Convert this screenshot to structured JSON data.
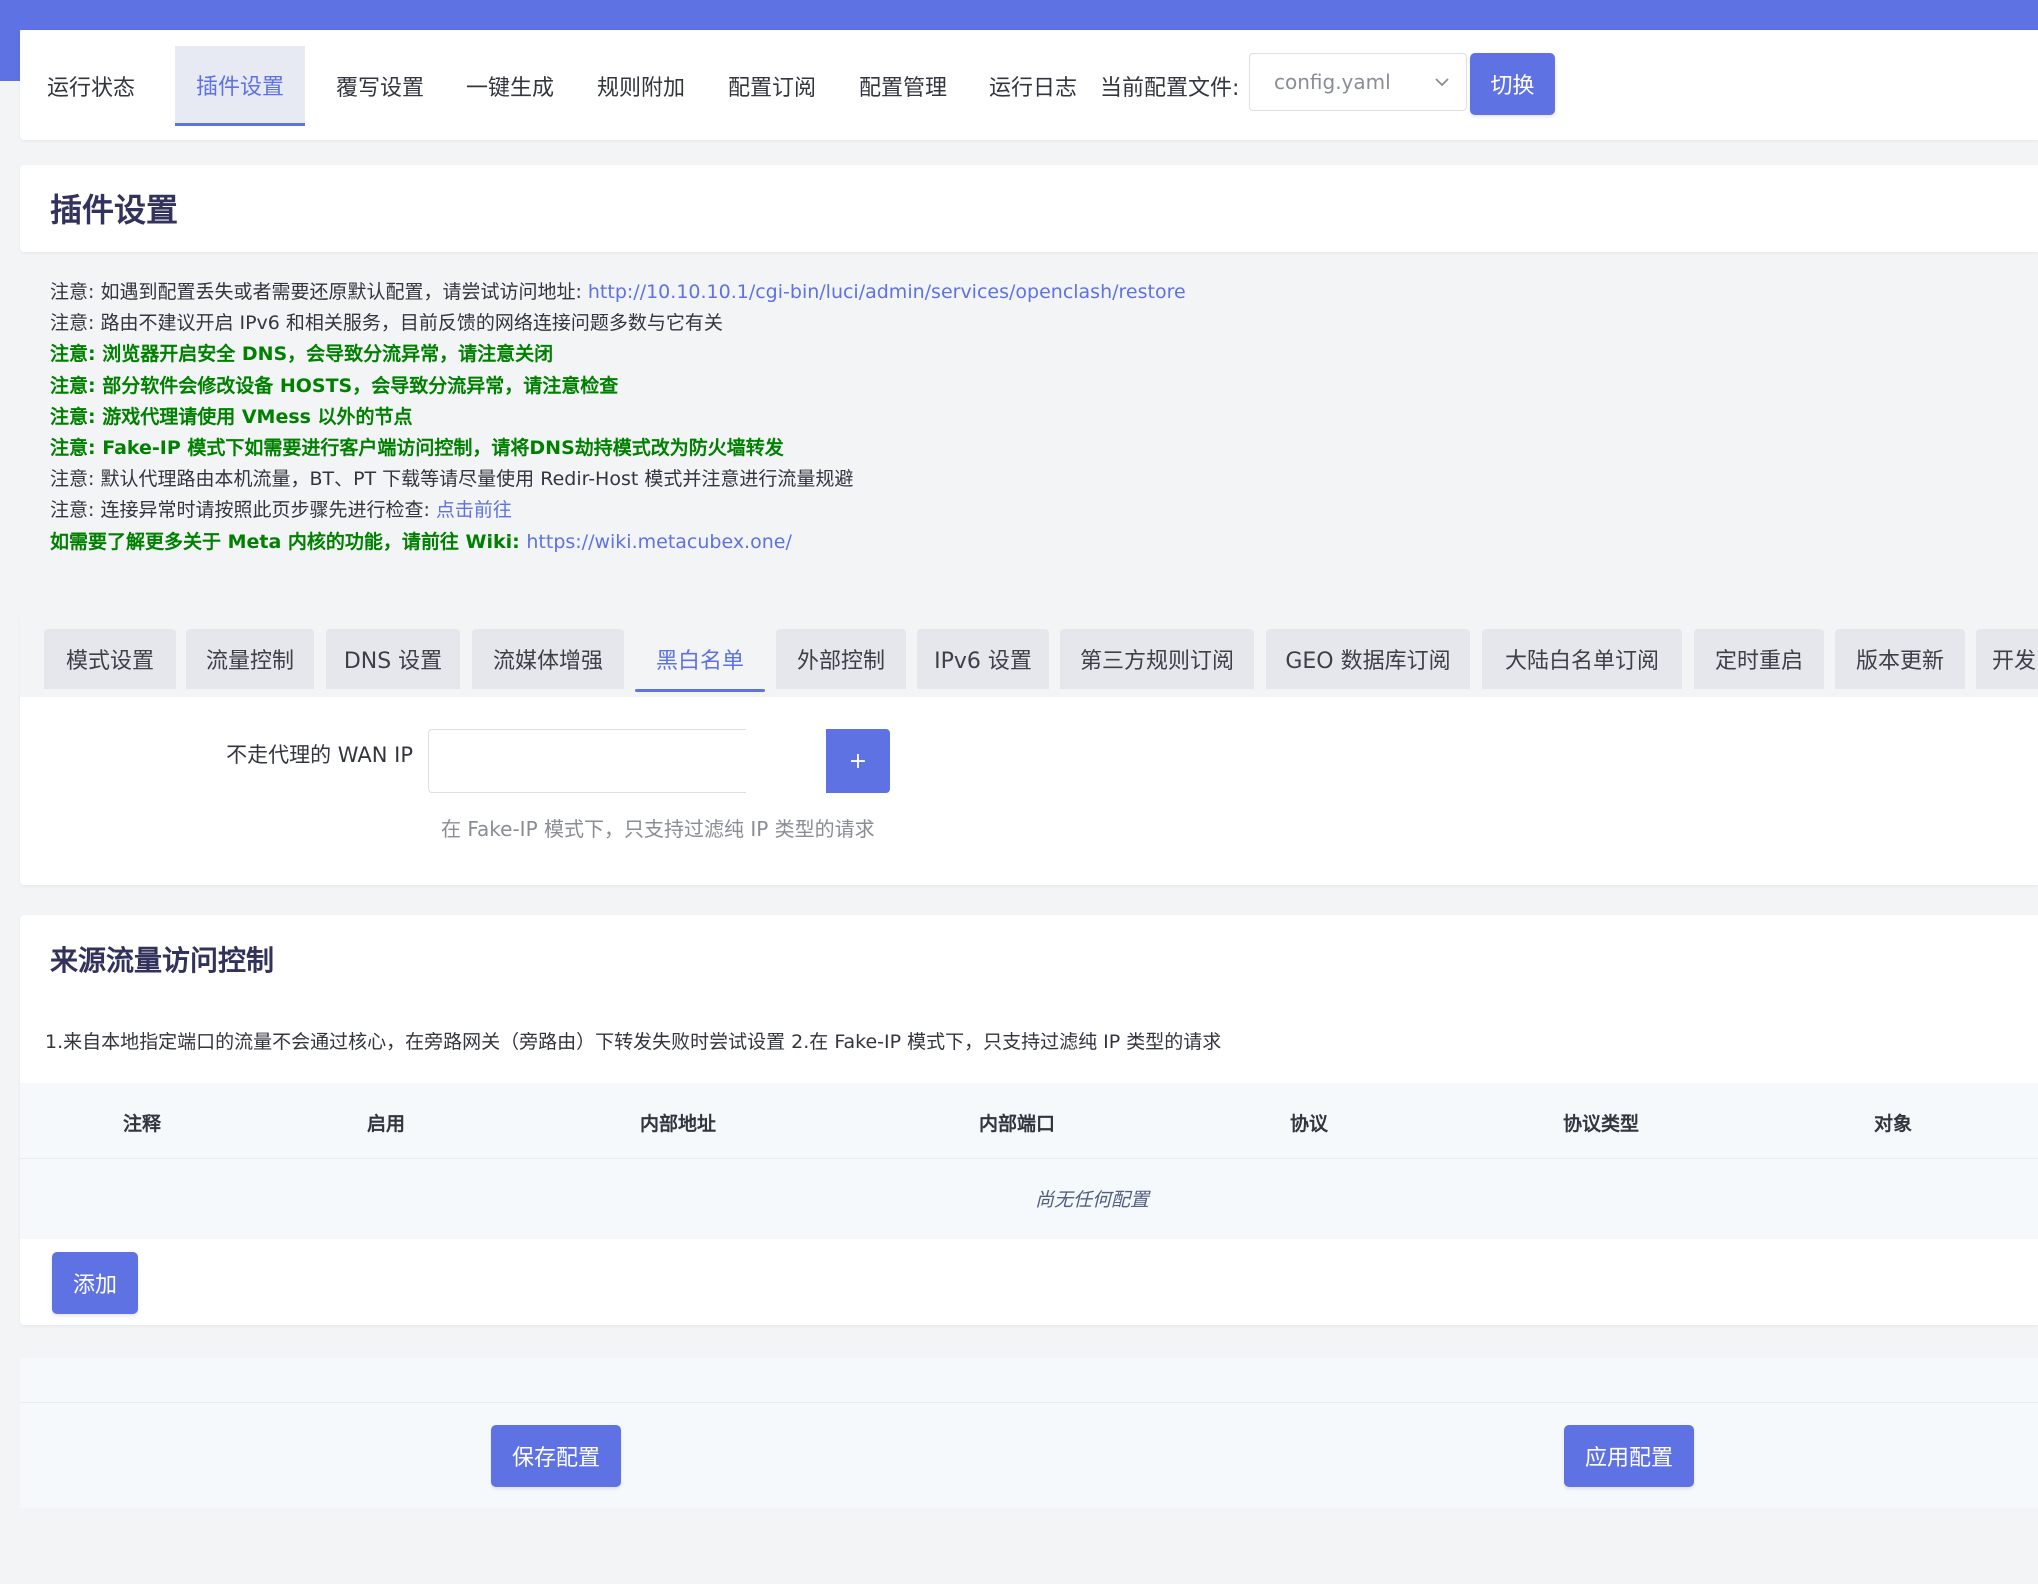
{
  "nav": {
    "items": [
      {
        "label": "运行状态",
        "active": false
      },
      {
        "label": "插件设置",
        "active": true
      },
      {
        "label": "覆写设置",
        "active": false
      },
      {
        "label": "一键生成",
        "active": false
      },
      {
        "label": "规则附加",
        "active": false
      },
      {
        "label": "配置订阅",
        "active": false
      },
      {
        "label": "配置管理",
        "active": false
      },
      {
        "label": "运行日志",
        "active": false
      }
    ],
    "config_label": "当前配置文件:",
    "config_value": "config.yaml",
    "switch_label": "切换"
  },
  "page_title": "插件设置",
  "notes": [
    {
      "text": "注意: 如遇到配置丢失或者需要还原默认配置，请尝试访问地址: ",
      "link": "http://10.10.10.1/cgi-bin/luci/admin/services/openclash/restore",
      "green": false
    },
    {
      "text": "注意: 路由不建议开启 IPv6 和相关服务，目前反馈的网络连接问题多数与它有关",
      "link": "",
      "green": false
    },
    {
      "text": "注意: 浏览器开启安全 DNS，会导致分流异常，请注意关闭",
      "link": "",
      "green": true
    },
    {
      "text": "注意: 部分软件会修改设备 HOSTS，会导致分流异常，请注意检查",
      "link": "",
      "green": true
    },
    {
      "text": "注意: 游戏代理请使用 VMess 以外的节点",
      "link": "",
      "green": true
    },
    {
      "text": "注意: Fake-IP 模式下如需要进行客户端访问控制，请将DNS劫持模式改为防火墙转发",
      "link": "",
      "green": true
    },
    {
      "text": "注意: 默认代理路由本机流量，BT、PT 下载等请尽量使用 Redir-Host 模式并注意进行流量规避",
      "link": "",
      "green": false
    },
    {
      "text": "注意: 连接异常时请按照此页步骤先进行检查: ",
      "link": "点击前往",
      "green": false
    },
    {
      "text": "如需要了解更多关于 Meta 内核的功能，请前往 Wiki: ",
      "link": "https://wiki.metacubex.one/",
      "green": true
    }
  ],
  "subtabs": [
    {
      "label": "模式设置",
      "active": false
    },
    {
      "label": "流量控制",
      "active": false
    },
    {
      "label": "DNS 设置",
      "active": false
    },
    {
      "label": "流媒体增强",
      "active": false
    },
    {
      "label": "黑白名单",
      "active": true
    },
    {
      "label": "外部控制",
      "active": false
    },
    {
      "label": "IPv6 设置",
      "active": false
    },
    {
      "label": "第三方规则订阅",
      "active": false
    },
    {
      "label": "GEO 数据库订阅",
      "active": false
    },
    {
      "label": "大陆白名单订阅",
      "active": false
    },
    {
      "label": "定时重启",
      "active": false
    },
    {
      "label": "版本更新",
      "active": false
    },
    {
      "label": "开发",
      "active": false
    }
  ],
  "wan_ip": {
    "label": "不走代理的 WAN IP",
    "value": "",
    "add_label": "+",
    "help": "在 Fake-IP 模式下，只支持过滤纯 IP 类型的请求"
  },
  "source_control": {
    "title": "来源流量访问控制",
    "desc": "1.来自本地指定端口的流量不会通过核心，在旁路网关（旁路由）下转发失败时尝试设置 2.在 Fake-IP 模式下，只支持过滤纯 IP 类型的请求",
    "columns": [
      "注释",
      "启用",
      "内部地址",
      "内部端口",
      "协议",
      "协议类型",
      "对象"
    ],
    "empty_text": "尚无任何配置",
    "add_label": "添加"
  },
  "footer": {
    "save_label": "保存配置",
    "apply_label": "应用配置"
  },
  "colors": {
    "accent": "#5e72e4",
    "green_note": "#008000"
  }
}
